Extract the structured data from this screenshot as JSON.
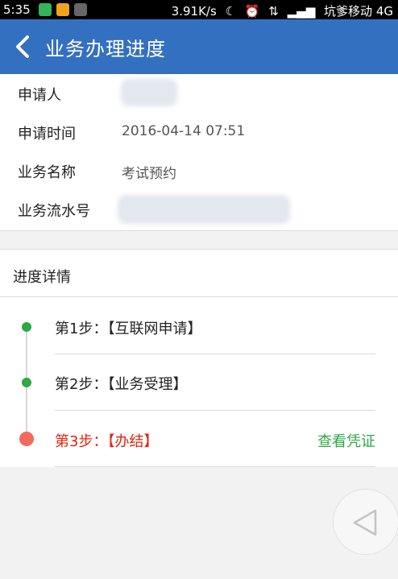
{
  "status_bar": {
    "time": "5:35",
    "net_speed": "3.91K/s",
    "carrier": "坑爹移动",
    "network": "4G"
  },
  "header": {
    "title": "业务办理进度"
  },
  "info": [
    {
      "label": "申请人",
      "value": ""
    },
    {
      "label": "申请时间",
      "value": "2016-04-14 07:51"
    },
    {
      "label": "业务名称",
      "value": "考试预约"
    },
    {
      "label": "业务流水号",
      "value": ""
    }
  ],
  "progress": {
    "title": "进度详情",
    "steps": [
      {
        "text": "第1步：【互联网申请】",
        "status": "done"
      },
      {
        "text": "第2步：【业务受理】",
        "status": "done"
      },
      {
        "text": "第3步：【办结】",
        "status": "current",
        "action": "查看凭证"
      }
    ]
  },
  "colors": {
    "header": "#3470c0",
    "done": "#2fa845",
    "current": "#e8210c"
  }
}
